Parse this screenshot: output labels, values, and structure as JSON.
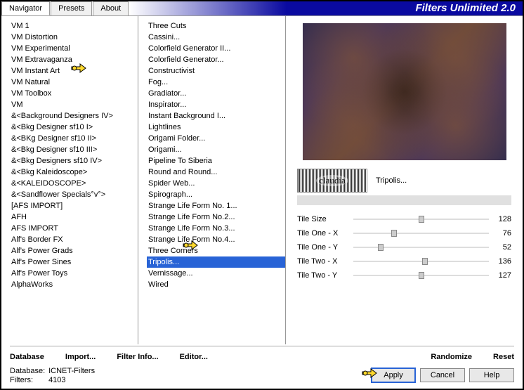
{
  "app_title": "Filters Unlimited 2.0",
  "tabs": [
    "Navigator",
    "Presets",
    "About"
  ],
  "active_tab": 0,
  "categories": [
    "VM 1",
    "VM Distortion",
    "VM Experimental",
    "VM Extravaganza",
    "VM Instant Art",
    "VM Natural",
    "VM Toolbox",
    "VM",
    "&<Background Designers IV>",
    "&<Bkg Designer sf10 I>",
    "&<BKg Designer sf10 II>",
    "&<Bkg Designer sf10 III>",
    "&<Bkg Designers sf10 IV>",
    "&<Bkg Kaleidoscope>",
    "&<KALEIDOSCOPE>",
    "&<Sandflower Specials°v°>",
    "[AFS IMPORT]",
    "AFH",
    "AFS IMPORT",
    "Alf's Border FX",
    "Alf's Power Grads",
    "Alf's Power Sines",
    "Alf's Power Toys",
    "AlphaWorks"
  ],
  "filters": [
    "Three Cuts",
    "Cassini...",
    "Colorfield Generator II...",
    "Colorfield Generator...",
    "Constructivist",
    "Fog...",
    "Gradiator...",
    "Inspirator...",
    "Instant Background I...",
    "Lightlines",
    "Origami Folder...",
    "Origami...",
    "Pipeline To Siberia",
    "Round and Round...",
    "Spider Web...",
    "Spirograph...",
    "Strange Life Form No. 1...",
    "Strange Life Form No.2...",
    "Strange Life Form No.3...",
    "Strange Life Form No.4...",
    "Three Corners",
    "Tripolis...",
    "Vernissage...",
    "Wired"
  ],
  "selected_filter_index": 21,
  "filter_name": "Tripolis...",
  "logo_text": "claudia",
  "sliders": [
    {
      "label": "Tile Size",
      "value": 128,
      "pct": 50
    },
    {
      "label": "Tile One - X",
      "value": 76,
      "pct": 30
    },
    {
      "label": "Tile One - Y",
      "value": 52,
      "pct": 20
    },
    {
      "label": "Tile Two - X",
      "value": 136,
      "pct": 53
    },
    {
      "label": "Tile Two - Y",
      "value": 127,
      "pct": 50
    }
  ],
  "row1": {
    "database": "Database",
    "import": "Import...",
    "filter_info": "Filter Info...",
    "editor": "Editor...",
    "randomize": "Randomize",
    "reset": "Reset"
  },
  "status": {
    "db_label": "Database:",
    "db_value": "ICNET-Filters",
    "filters_label": "Filters:",
    "filters_value": "4103"
  },
  "buttons": {
    "apply": "Apply",
    "cancel": "Cancel",
    "help": "Help"
  }
}
